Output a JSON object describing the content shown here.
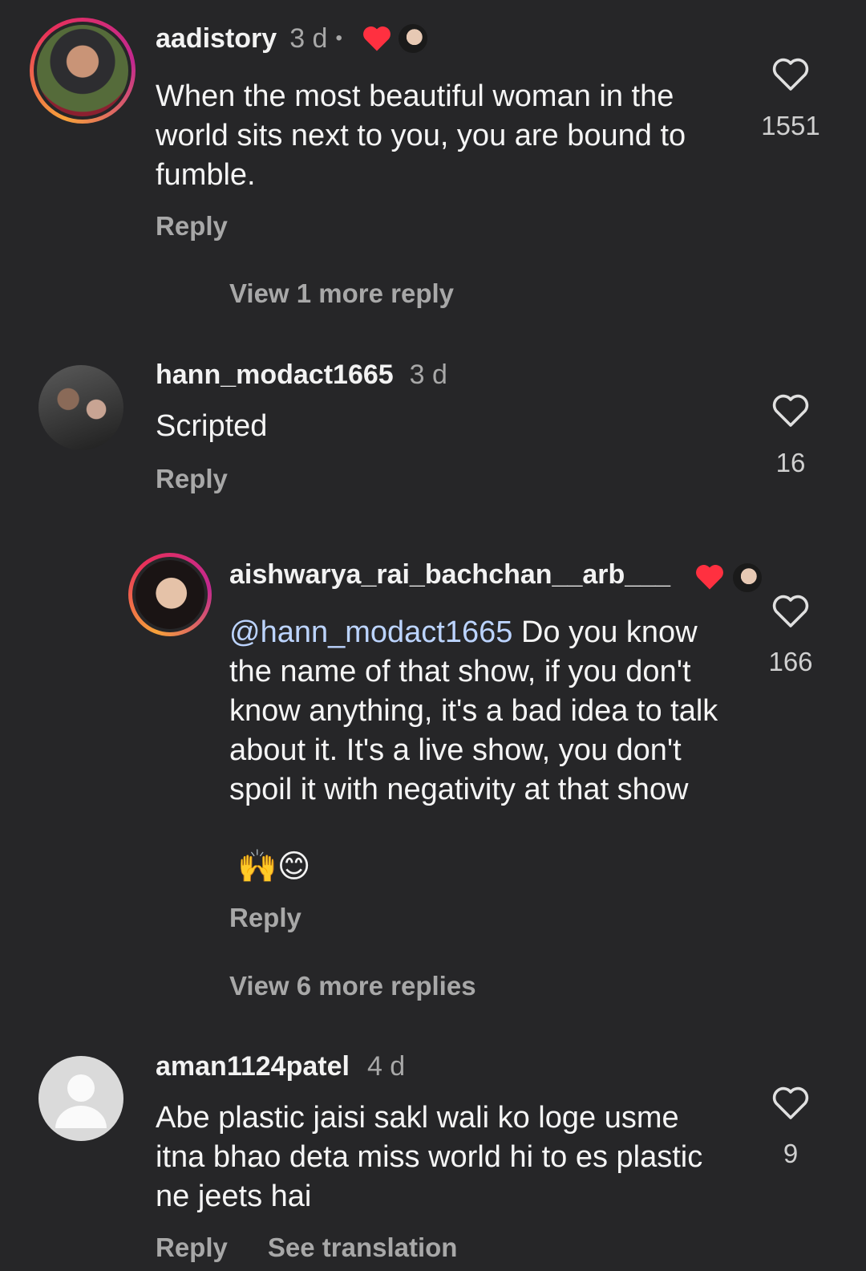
{
  "comments": [
    {
      "username": "aadistory",
      "time": "3 d",
      "dot": "•",
      "text": "When the most beautiful woman in the world sits next to you, you are bound to fumble.",
      "likes": "1551",
      "reply_label": "Reply",
      "view_replies": "View 1 more reply"
    },
    {
      "username": "hann_modact1665",
      "time": "3 d",
      "text": "Scripted",
      "likes": "16",
      "reply_label": "Reply"
    },
    {
      "username": "aishwarya_rai_bachchan__arb___",
      "mention": "@hann_modact1665",
      "text": " Do you know the name of that show, if you don't know anything, it's a bad idea to talk about it. It's a live show, you don't spoil it with negativity at that show",
      "emoji": "🙌😊",
      "likes": "166",
      "reply_label": "Reply",
      "view_replies": "View 6 more replies"
    },
    {
      "username": "aman1124patel",
      "time": "4 d",
      "text": "Abe plastic jaisi sakl wali ko loge usme itna bhao deta miss world hi to es plastic ne jeets hai",
      "likes": "9",
      "reply_label": "Reply",
      "translate_label": "See translation"
    }
  ],
  "colors": {
    "background": "#262628",
    "liked_heart": "#ff3040",
    "secondary_text": "#a8a8a8"
  },
  "icons": [
    "heart-outline-icon",
    "heart-filled-icon",
    "default-avatar-icon"
  ]
}
